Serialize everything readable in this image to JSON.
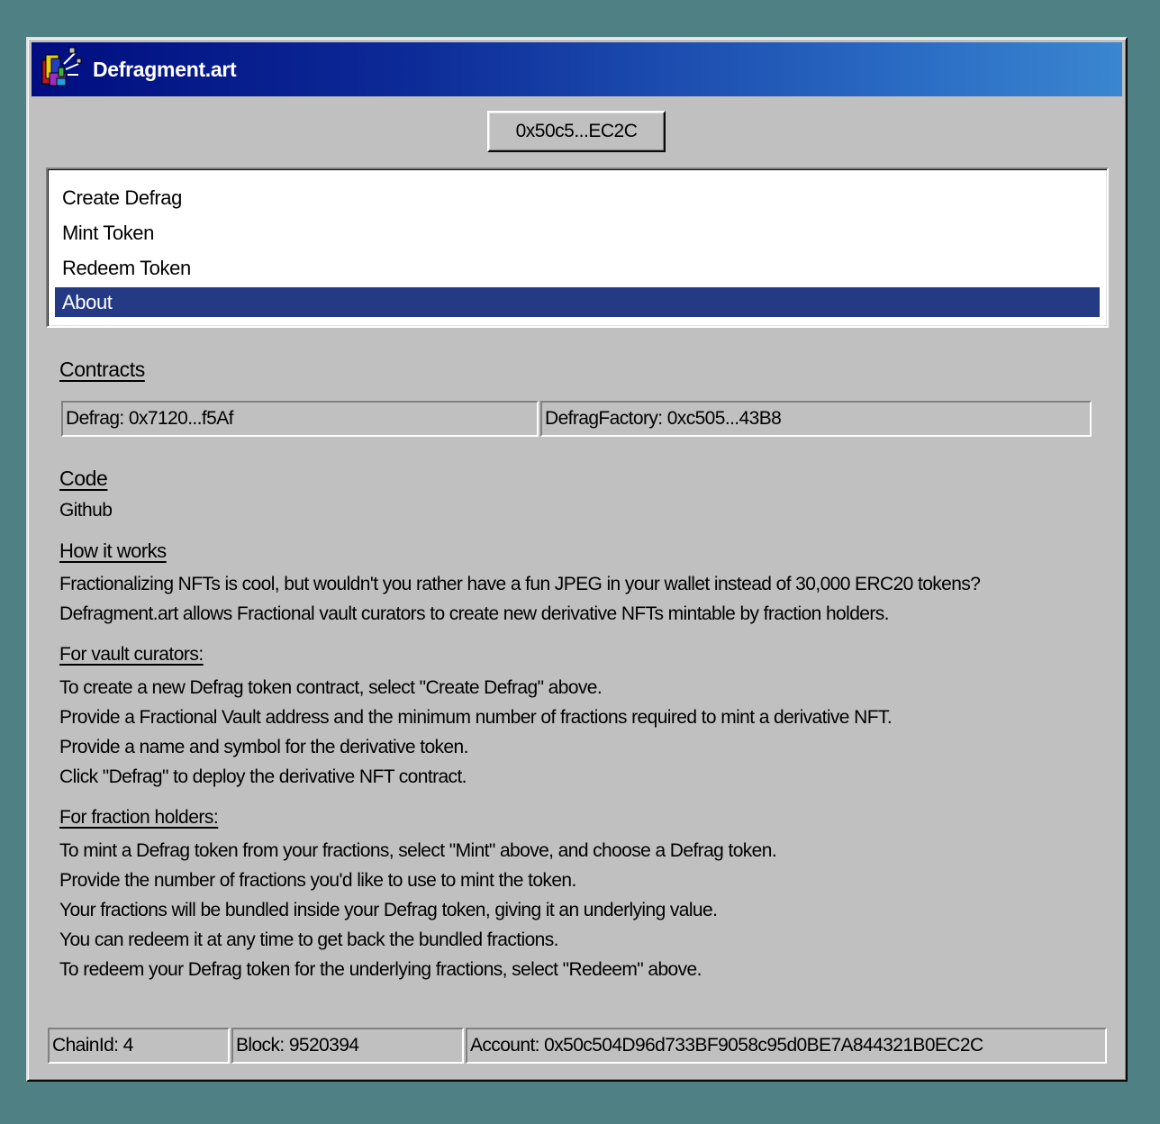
{
  "window": {
    "title": "Defragment.art",
    "icon": "defrag-app-icon"
  },
  "account_button": {
    "label": "0x50c5...EC2C"
  },
  "menu": {
    "items": [
      {
        "label": "Create Defrag",
        "selected": false
      },
      {
        "label": "Mint Token",
        "selected": false
      },
      {
        "label": "Redeem Token",
        "selected": false
      },
      {
        "label": "About",
        "selected": true
      }
    ]
  },
  "contracts": {
    "heading": "Contracts",
    "defrag": "Defrag: 0x7120...f5Af",
    "factory": "DefragFactory: 0xc505...43B8"
  },
  "code": {
    "heading": "Code",
    "link": "Github"
  },
  "how_it_works": {
    "heading": "How it works",
    "lines": [
      "Fractionalizing NFTs is cool, but wouldn't you rather have a fun JPEG in your wallet instead of 30,000 ERC20 tokens?",
      "Defragment.art allows Fractional vault curators to create new derivative NFTs mintable by fraction holders."
    ]
  },
  "curators": {
    "heading": "For vault curators:",
    "lines": [
      "To create a new Defrag token contract, select \"Create Defrag\" above.",
      "Provide a Fractional Vault address and the minimum number of fractions required to mint a derivative NFT.",
      "Provide a name and symbol for the derivative token.",
      "Click \"Defrag\" to deploy the derivative NFT contract."
    ]
  },
  "holders": {
    "heading": "For fraction holders:",
    "lines": [
      "To mint a Defrag token from your fractions, select \"Mint\" above, and choose a Defrag token.",
      "Provide the number of fractions you'd like to use to mint the token.",
      "Your fractions will be bundled inside your Defrag token, giving it an underlying value.",
      "You can redeem it at any time to get back the bundled fractions.",
      "To redeem your Defrag token for the underlying fractions, select \"Redeem\" above."
    ]
  },
  "status_bar": {
    "chain": "ChainId: 4",
    "block": "Block: 9520394",
    "account": "Account: 0x50c504D96d733BF9058c95d0BE7A844321B0EC2C"
  },
  "colors": {
    "desktop": "#4f8184",
    "window_bg": "#c0c0c0",
    "title_start": "#000d80",
    "title_end": "#3a86d0",
    "selection": "#243a84"
  }
}
